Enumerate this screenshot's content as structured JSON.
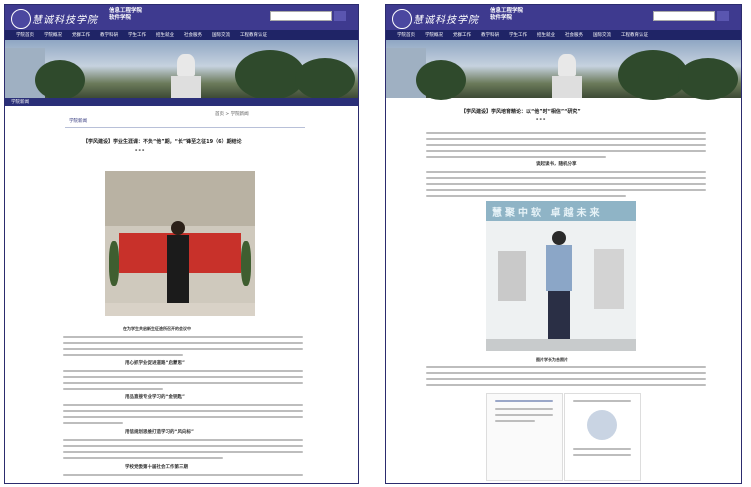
{
  "site": {
    "brand": "慧诚科技学院",
    "college_line1": "信息工程学院",
    "college_line2": "软件学院"
  },
  "nav_items": [
    "学院首页",
    "学院概况",
    "党群工作",
    "教学科研",
    "学生工作",
    "招生就业",
    "社会服务",
    "国际交流",
    "工程教育认证"
  ],
  "colors": {
    "header": "#3e3a8f",
    "nav": "#1f2466",
    "subbar": "#2a2f78"
  },
  "left": {
    "section_label": "学院新闻",
    "tab_label": "学院新闻",
    "breadcrumb": "首页 > 学院新闻",
    "article_title": "【学风建设】学业生涯课：不负“他”期，“长”锋至之征19（6）期结论",
    "photo_caption": "在为学生共启新生征途所召开的会议中",
    "section_heads": [
      "用心抓学业促进道路“启蒙思”",
      "用品直接专业学习的“金钥匙”",
      "用信规划思维打造学习的“风向标”",
      "学校党委第十届社会工作第三期"
    ]
  },
  "right": {
    "article_title": "【学风建设】学风培育精论：以“他”时“相信”“研究”",
    "section_head": "谈起读书，随机分享",
    "photo_caption": "图片学长为合照片",
    "banner_text": "慧聚中软 卓越未来"
  }
}
